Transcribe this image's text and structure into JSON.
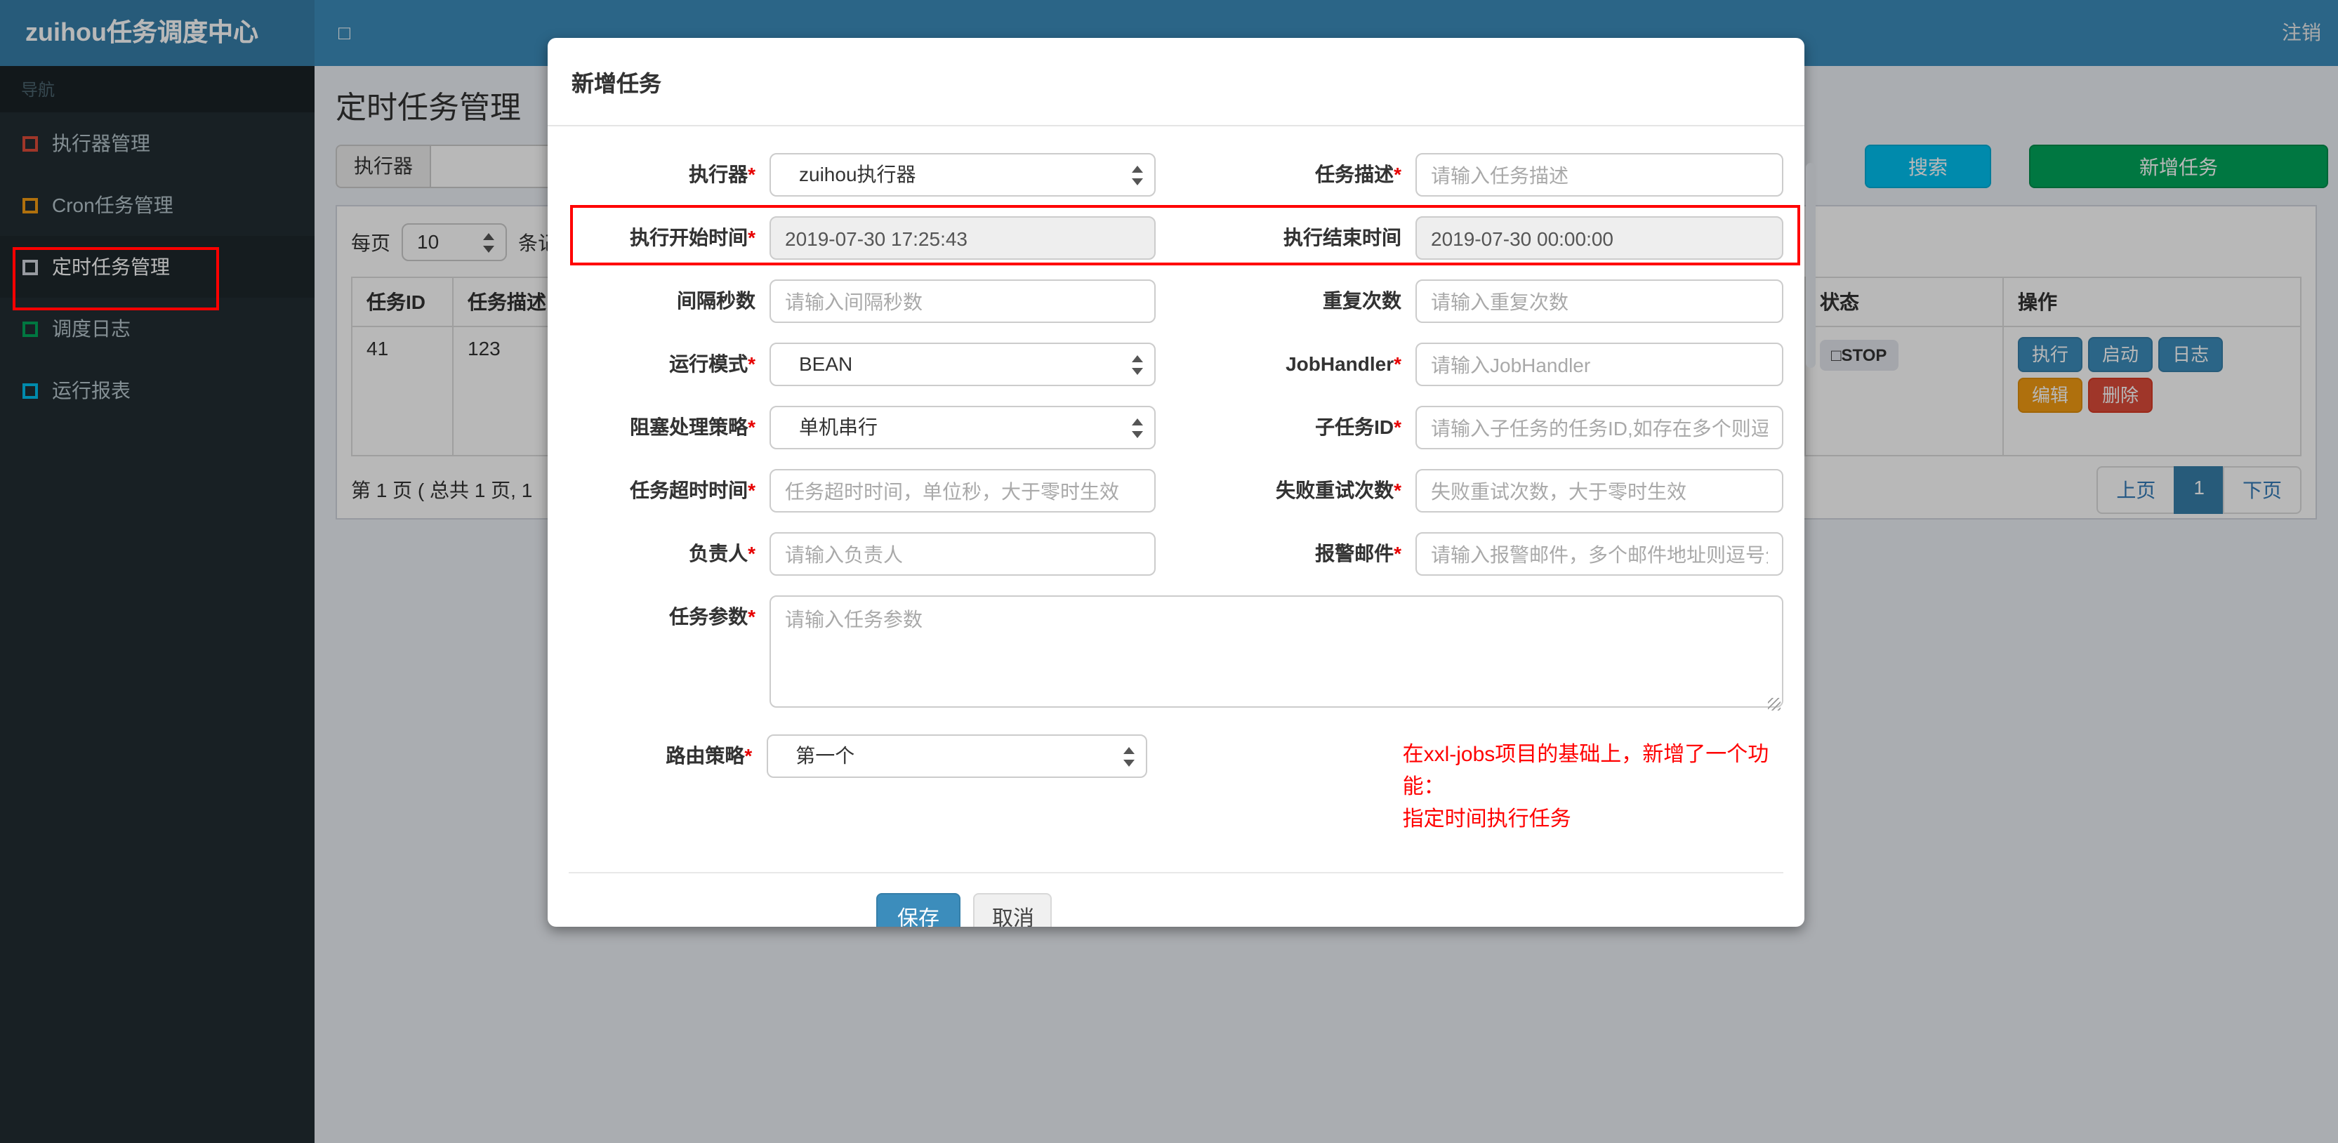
{
  "navbar": {
    "brand": "zuihou任务调度中心",
    "toggle_icon": "□",
    "logout": "注销"
  },
  "sidebar": {
    "nav_header": "导航",
    "items": [
      {
        "label": "执行器管理",
        "icon": "square-outline-red",
        "color": "#dd4b39",
        "active": false
      },
      {
        "label": "Cron任务管理",
        "icon": "square-outline-yellow",
        "color": "#f39c12",
        "active": false
      },
      {
        "label": "定时任务管理",
        "icon": "square-outline-gray",
        "color": "#d2d6de",
        "active": true
      },
      {
        "label": "调度日志",
        "icon": "square-outline-green",
        "color": "#00a65a",
        "active": false
      },
      {
        "label": "运行报表",
        "icon": "square-outline-aqua",
        "color": "#00c0ef",
        "active": false
      }
    ]
  },
  "page": {
    "title": "定时任务管理",
    "filter_addon": "执行器",
    "search_button": "搜索",
    "add_button": "新增任务",
    "toolbar": {
      "prefix": "每页",
      "page_size": "10",
      "suffix": "条记录"
    },
    "pagination": {
      "info": "第 1 页 ( 总共 1 页, 1",
      "prev": "上页",
      "page": "1",
      "next": "下页"
    }
  },
  "table": {
    "columns": [
      "任务ID",
      "任务描述",
      "状态",
      "操作"
    ],
    "row": {
      "job_id": "41",
      "job_desc": "123",
      "status": "□STOP",
      "actions": {
        "run": "执行",
        "start": "启动",
        "log": "日志",
        "edit": "编辑",
        "delete": "删除"
      }
    }
  },
  "modal": {
    "title": "新增任务",
    "form": {
      "rows": [
        {
          "label1": "执行器",
          "star1": "*",
          "field1_value": "zuihou执行器",
          "label2": "任务描述",
          "star2": "*",
          "field2_placeholder": "请输入任务描述"
        },
        {
          "label1": "执行开始时间",
          "star1": "*",
          "field1_value": "2019-07-30 17:25:43",
          "label2": "执行结束时间",
          "field2_value": "2019-07-30 00:00:00"
        },
        {
          "label1": "间隔秒数",
          "field1_placeholder": "请输入间隔秒数",
          "label2": "重复次数",
          "field2_placeholder": "请输入重复次数"
        },
        {
          "label1": "运行模式",
          "star1": "*",
          "field1_value": "BEAN",
          "label2": "JobHandler",
          "star2": "*",
          "field2_placeholder": "请输入JobHandler"
        },
        {
          "label1": "阻塞处理策略",
          "star1": "*",
          "field1_value": "单机串行",
          "label2": "子任务ID",
          "star2": "*",
          "field2_placeholder": "请输入子任务的任务ID,如存在多个则逗号分隔"
        },
        {
          "label1": "任务超时时间",
          "star1": "*",
          "field1_placeholder": "任务超时时间，单位秒，大于零时生效",
          "label2": "失败重试次数",
          "star2": "*",
          "field2_placeholder": "失败重试次数，大于零时生效"
        },
        {
          "label1": "负责人",
          "star1": "*",
          "field1_placeholder": "请输入负责人",
          "label2": "报警邮件",
          "star2": "*",
          "field2_placeholder": "请输入报警邮件，多个邮件地址则逗号分隔"
        }
      ],
      "param_label": "任务参数",
      "param_star": "*",
      "param_placeholder": "请输入任务参数",
      "route_label": "路由策略",
      "route_star": "*",
      "route_value": "第一个",
      "note_line1": "在xxl-jobs项目的基础上，新增了一个功能：",
      "note_line2": "指定时间执行任务",
      "save": "保存",
      "cancel": "取消"
    }
  },
  "colors": {
    "navbar_blue": "#3c8dbc",
    "logo_blue": "#367fa9",
    "sidebar_dark": "#222d32",
    "info_cyan": "#00c0ef",
    "success_green": "#00a65a",
    "primary_blue": "#3c8dbc",
    "warning_orange": "#f39c12",
    "danger_red": "#dd4b39",
    "annotation_red": "#ff0000",
    "active_page_blue": "#367fa9"
  }
}
